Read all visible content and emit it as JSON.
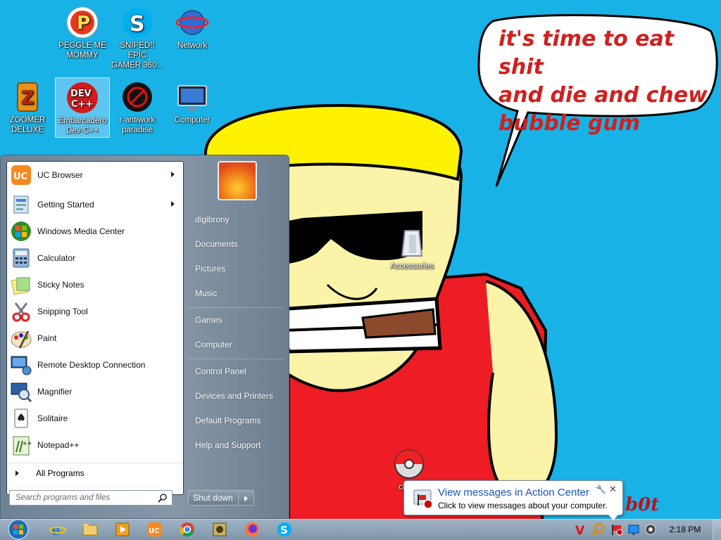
{
  "wallpaper": {
    "speech_line1": "it's time to eat shit",
    "speech_line2": "and die and chew",
    "speech_line3": "bubble gum",
    "signature": "b0t"
  },
  "desktop_icons": [
    {
      "label_line1": "PEGGLE ME",
      "label_line2": "MOMMY",
      "icon": "peggle-icon"
    },
    {
      "label_line1": "SNIPED!! EPIC",
      "label_line2": "GAMER 360...",
      "icon": "skype-icon"
    },
    {
      "label_line1": "Network",
      "label_line2": "",
      "icon": "network-icon"
    },
    {
      "label_line1": "ZOOMER",
      "label_line2": "DELUXE",
      "icon": "zoomer-icon"
    },
    {
      "label_line1": "Embarcadero",
      "label_line2": "Dev-C++",
      "icon": "devcpp-icon"
    },
    {
      "label_line1": "r-antiwork",
      "label_line2": "paradise",
      "icon": "antiwork-icon"
    },
    {
      "label_line1": "Computer",
      "label_line2": "",
      "icon": "computer-icon"
    },
    {
      "label_line1": "Accessories",
      "label_line2": "",
      "icon": "folder-icon"
    },
    {
      "label_line1": "cl",
      "label_line2": "",
      "icon": "pokeball-icon"
    }
  ],
  "start_menu": {
    "programs": [
      {
        "label": "UC Browser",
        "icon": "uc-browser-icon",
        "has_submenu": true
      },
      {
        "label": "Getting Started",
        "icon": "getting-started-icon",
        "has_submenu": true
      },
      {
        "label": "Windows Media Center",
        "icon": "media-center-icon",
        "has_submenu": false
      },
      {
        "label": "Calculator",
        "icon": "calculator-icon",
        "has_submenu": false
      },
      {
        "label": "Sticky Notes",
        "icon": "sticky-notes-icon",
        "has_submenu": false
      },
      {
        "label": "Snipping Tool",
        "icon": "snipping-tool-icon",
        "has_submenu": false
      },
      {
        "label": "Paint",
        "icon": "paint-icon",
        "has_submenu": false
      },
      {
        "label": "Remote Desktop Connection",
        "icon": "remote-desktop-icon",
        "has_submenu": false
      },
      {
        "label": "Magnifier",
        "icon": "magnifier-icon",
        "has_submenu": false
      },
      {
        "label": "Solitaire",
        "icon": "solitaire-icon",
        "has_submenu": false
      },
      {
        "label": "Notepad++",
        "icon": "notepad-plus-icon",
        "has_submenu": false
      }
    ],
    "all_programs": "All Programs",
    "search_placeholder": "Search programs and files",
    "right_links": [
      "digibrony",
      "Documents",
      "Pictures",
      "Music",
      "Games",
      "Computer",
      "Control Panel",
      "Devices and Printers",
      "Default Programs",
      "Help and Support"
    ],
    "shutdown_label": "Shut down"
  },
  "taskbar": {
    "pinned": [
      "internet-explorer-icon",
      "explorer-folder-icon",
      "media-player-icon",
      "uc-browser-icon",
      "chrome-icon",
      "game-icon",
      "firefox-icon",
      "skype-icon"
    ],
    "tray": [
      "v-tray-icon",
      "search-tray-icon",
      "action-center-flag-icon",
      "network-tray-icon",
      "volume-tray-icon"
    ],
    "clock": "2:18 PM"
  },
  "notification": {
    "title": "View messages in Action Center",
    "subtitle": "Click to view messages about your computer."
  },
  "colors": {
    "desktop": "#19b2e6",
    "accent_text": "#1c55b8",
    "speech_text": "#d02020"
  }
}
